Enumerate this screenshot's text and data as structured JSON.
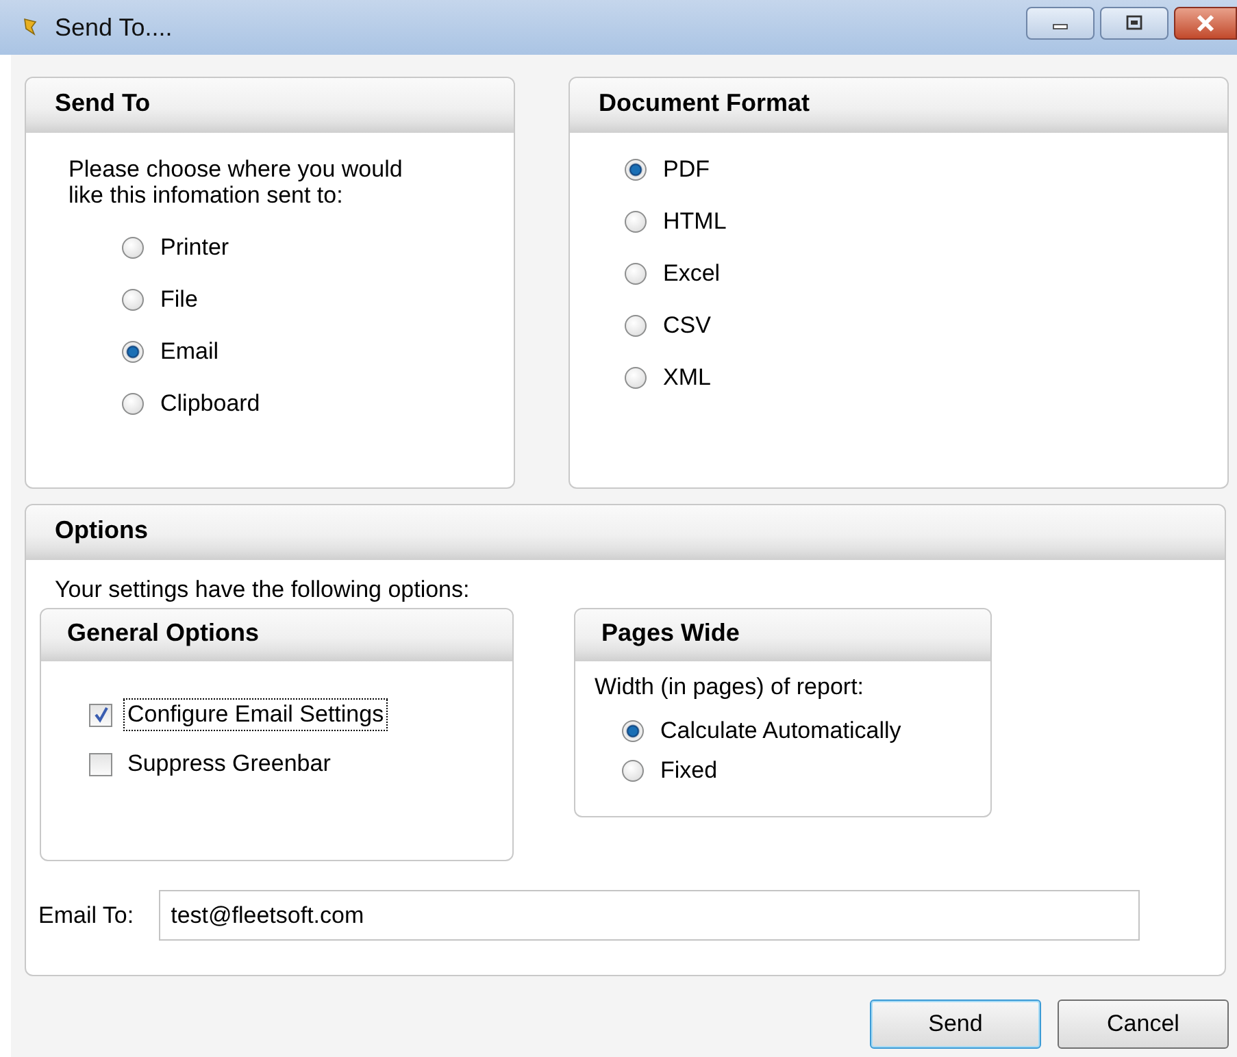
{
  "window": {
    "title": "Send To...."
  },
  "send_to": {
    "title": "Send To",
    "prompt": "Please choose where you would like this infomation sent to:",
    "options": [
      {
        "label": "Printer",
        "selected": false
      },
      {
        "label": "File",
        "selected": false
      },
      {
        "label": "Email",
        "selected": true
      },
      {
        "label": "Clipboard",
        "selected": false
      }
    ]
  },
  "document_format": {
    "title": "Document Format",
    "options": [
      {
        "label": "PDF",
        "selected": true
      },
      {
        "label": "HTML",
        "selected": false
      },
      {
        "label": "Excel",
        "selected": false
      },
      {
        "label": "CSV",
        "selected": false
      },
      {
        "label": "XML",
        "selected": false
      }
    ]
  },
  "options": {
    "title": "Options",
    "intro": "Your settings have the following options:",
    "general": {
      "title": "General Options",
      "items": [
        {
          "label": "Configure Email Settings",
          "checked": true,
          "focused": true
        },
        {
          "label": "Suppress Greenbar",
          "checked": false,
          "focused": false
        }
      ]
    },
    "pages_wide": {
      "title": "Pages Wide",
      "prompt": "Width (in pages) of report:",
      "options": [
        {
          "label": "Calculate Automatically",
          "selected": true
        },
        {
          "label": "Fixed",
          "selected": false
        }
      ]
    },
    "email_to": {
      "label": "Email To:",
      "value": "test@fleetsoft.com"
    }
  },
  "buttons": [
    {
      "label": "Send",
      "default": true
    },
    {
      "label": "Cancel",
      "default": false
    }
  ]
}
